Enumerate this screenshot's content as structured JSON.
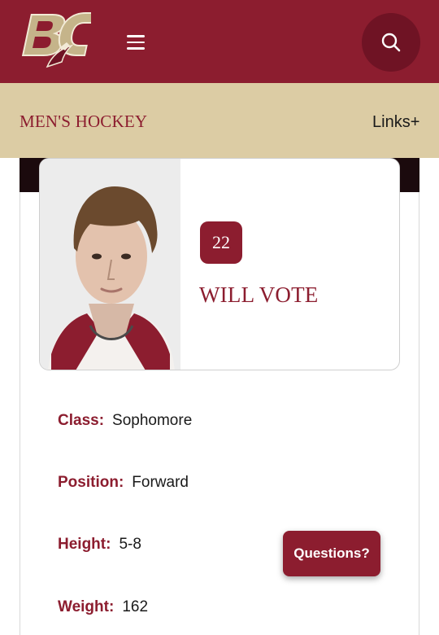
{
  "header": {
    "logo_text": "BC",
    "menu_icon": "hamburger-menu-icon",
    "search_icon": "search-icon",
    "brand_color": "#8c1d2f",
    "accent_color": "#dccca4"
  },
  "subnav": {
    "sport_title": "MEN'S HOCKEY",
    "links_label": "Links+"
  },
  "player": {
    "number": "22",
    "name": "WILL VOTE"
  },
  "details": [
    {
      "label": "Class:",
      "value": "Sophomore"
    },
    {
      "label": "Position:",
      "value": "Forward"
    },
    {
      "label": "Height:",
      "value": "5-8"
    },
    {
      "label": "Weight:",
      "value": "162"
    }
  ],
  "help_button": {
    "label": "Questions?"
  }
}
